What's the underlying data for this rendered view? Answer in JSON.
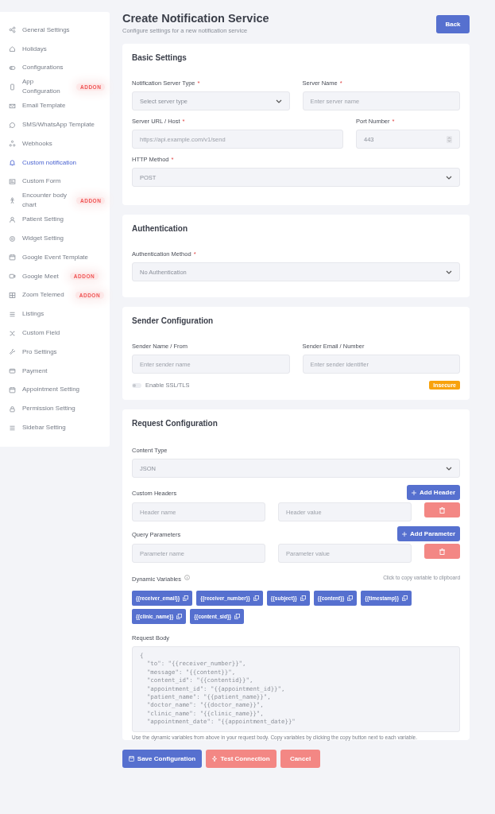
{
  "sidebar": {
    "items": [
      {
        "label": "General Settings",
        "selected": false
      },
      {
        "label": "Holidays",
        "selected": false
      },
      {
        "label": "Configurations",
        "selected": false
      },
      {
        "label": "App Configuration",
        "selected": false,
        "badge": "ADDON"
      },
      {
        "label": "Email Template",
        "selected": false
      },
      {
        "label": "SMS/WhatsApp Template",
        "selected": false
      },
      {
        "label": "Webhooks",
        "selected": false
      },
      {
        "label": "Custom notification",
        "selected": true
      },
      {
        "label": "Custom Form",
        "selected": false
      },
      {
        "label": "Encounter body chart",
        "selected": false,
        "badge": "ADDON"
      },
      {
        "label": "Patient Setting",
        "selected": false
      },
      {
        "label": "Widget Setting",
        "selected": false
      },
      {
        "label": "Google Event Template",
        "selected": false
      },
      {
        "label": "Google Meet",
        "selected": false,
        "badge": "ADDON"
      },
      {
        "label": "Zoom Telemed",
        "selected": false,
        "badge": "ADDON"
      },
      {
        "label": "Listings",
        "selected": false
      },
      {
        "label": "Custom Field",
        "selected": false
      },
      {
        "label": "Pro Settings",
        "selected": false
      },
      {
        "label": "Payment",
        "selected": false
      },
      {
        "label": "Appointment Setting",
        "selected": false
      },
      {
        "label": "Permission Setting",
        "selected": false
      },
      {
        "label": "Sidebar Setting",
        "selected": false
      }
    ]
  },
  "header": {
    "title": "Create Notification Service",
    "subtitle": "Configure settings for a new notification service",
    "back_button": "Back"
  },
  "basic_settings": {
    "title": "Basic Settings",
    "rows": [
      [
        {
          "label": "Notification Server Type",
          "required_mark": "*",
          "kind": "select",
          "placeholder": "Select server type"
        },
        {
          "label": "Server Name",
          "required_mark": "*",
          "kind": "input",
          "placeholder": "Enter server name"
        }
      ],
      [
        {
          "label": "Server URL / Host",
          "required_mark": "*",
          "kind": "input",
          "placeholder": "https://api.example.com/v1/send"
        },
        {
          "label": "Port Number",
          "required_mark": "*",
          "kind": "number",
          "value": "443"
        }
      ],
      [
        {
          "label": "HTTP Method",
          "required_mark": "*",
          "kind": "select",
          "value": "POST"
        }
      ]
    ]
  },
  "authentication": {
    "title": "Authentication",
    "rows": [
      [
        {
          "label": "Authentication Method",
          "required_mark": "*",
          "kind": "select",
          "value": "No Authentication"
        }
      ]
    ]
  },
  "sender_configuration": {
    "title": "Sender Configuration",
    "rows": [
      [
        {
          "label": "Sender Name / From",
          "kind": "input",
          "placeholder": "Enter sender name"
        },
        {
          "label": "Sender Email / Number",
          "kind": "input",
          "placeholder": "Enter sender identifier"
        }
      ]
    ],
    "ssl_toggle": {
      "label": "Enable SSL/TLS",
      "on": false
    },
    "security_badge": "Insecure"
  },
  "request_configuration": {
    "title": "Request Configuration",
    "content_type": {
      "label": "Content Type",
      "value": "JSON"
    },
    "custom_headers": {
      "label": "Custom Headers",
      "add_button": "Add Header",
      "name_placeholder": "Header name",
      "value_placeholder": "Header value"
    },
    "query_parameters": {
      "label": "Query Parameters",
      "add_button": "Add Parameter",
      "name_placeholder": "Parameter name",
      "value_placeholder": "Parameter value"
    },
    "dynamic_variables": {
      "label": "Dynamic Variables",
      "hint": "Click to copy variable to clipboard",
      "variables": [
        "{{receiver_email}}",
        "{{receiver_number}}",
        "{{subject}}",
        "{{content}}",
        "{{timestamp}}",
        "{{clinic_name}}",
        "{{content_sid}}"
      ]
    },
    "request_body": {
      "label": "Request Body",
      "value": "{\n  \"to\": \"{{receiver_number}}\",\n  \"message\": \"{{content}}\",\n  \"content_id\": \"{{contentid}}\",\n  \"appointment_id\": \"{{appointment_id}}\",\n  \"patient_name\": \"{{patient_name}}\",\n  \"doctor_name\": \"{{doctor_name}}\",\n  \"clinic_name\": \"{{clinic_name}}\",\n  \"appointment_date\": \"{{appointment_date}}\"",
      "help": "Use the dynamic variables from above in your request body. Copy variables by clicking the copy button next to each variable."
    }
  },
  "actions": {
    "save": "Save Configuration",
    "test": "Test Connection",
    "cancel": "Cancel"
  }
}
